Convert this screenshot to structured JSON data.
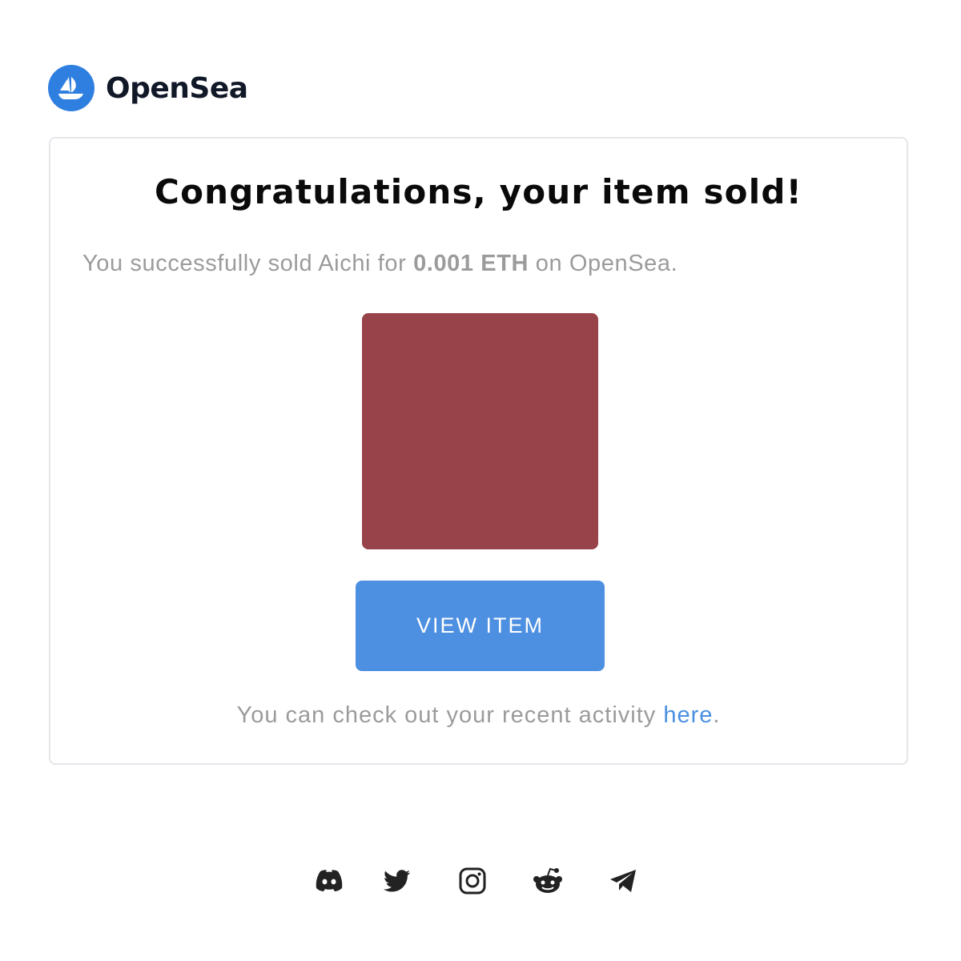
{
  "brand": {
    "name": "OpenSea",
    "logo_icon": "opensea-ship-icon",
    "logo_color": "#2f7fe0"
  },
  "email": {
    "headline": "Congratulations, your item sold!",
    "sold_prefix": "You successfully sold Aichi for ",
    "sold_price": "0.001 ETH",
    "sold_suffix": " on OpenSea.",
    "item_color": "#98434a",
    "button_label": "VIEW ITEM",
    "button_color": "#4d8fe0",
    "activity_prefix": "You can check out your recent activity ",
    "activity_link": "here",
    "activity_suffix": ".",
    "link_color": "#4a90e2"
  },
  "footer": {
    "social_icons": [
      "discord-icon",
      "twitter-icon",
      "instagram-icon",
      "reddit-icon",
      "telegram-icon"
    ]
  }
}
